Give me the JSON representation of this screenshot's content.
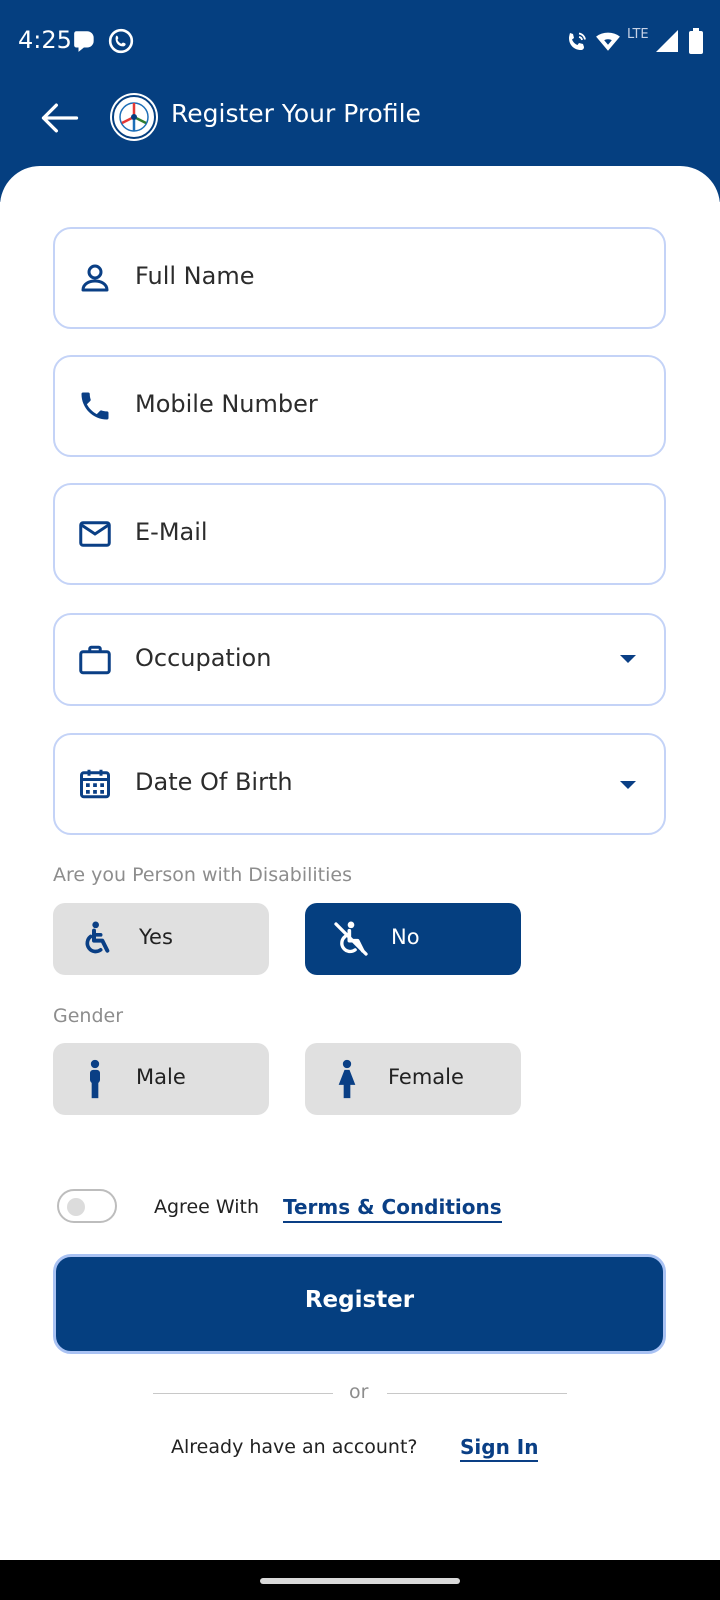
{
  "status_bar": {
    "time": "4:25",
    "network_label": "LTE",
    "icons": [
      "notification-icon",
      "whatsapp-icon",
      "wifi-calling-icon",
      "wifi-icon",
      "signal-icon",
      "battery-icon"
    ]
  },
  "app_bar": {
    "title": "Register Your Profile",
    "back_icon": "arrow-left-icon",
    "logo_icon": "app-logo"
  },
  "form": {
    "full_name": {
      "placeholder": "Full Name",
      "icon": "person-icon"
    },
    "mobile": {
      "placeholder": "Mobile Number",
      "icon": "phone-icon"
    },
    "email": {
      "placeholder": "E-Mail",
      "icon": "mail-icon"
    },
    "occupation": {
      "placeholder": "Occupation",
      "icon": "briefcase-icon"
    },
    "dob": {
      "placeholder": "Date Of Birth",
      "icon": "calendar-icon"
    }
  },
  "disability": {
    "label": "Are you Person with Disabilities",
    "options": [
      {
        "label": "Yes",
        "icon": "accessible-icon",
        "selected": false
      },
      {
        "label": "No",
        "icon": "not-accessible-icon",
        "selected": true
      }
    ]
  },
  "gender": {
    "label": "Gender",
    "options": [
      {
        "label": "Male",
        "icon": "male-icon",
        "selected": false
      },
      {
        "label": "Female",
        "icon": "female-icon",
        "selected": false
      }
    ]
  },
  "terms": {
    "agree_text": "Agree With",
    "link_text": "Terms & Conditions",
    "checked": false
  },
  "register_label": "Register",
  "divider_text": "or",
  "signin": {
    "prompt": "Already have an account?",
    "link_text": "Sign In"
  },
  "colors": {
    "primary": "#053f80",
    "field_border": "#c4d3f7",
    "unselected_bg": "#e0e0e0"
  }
}
